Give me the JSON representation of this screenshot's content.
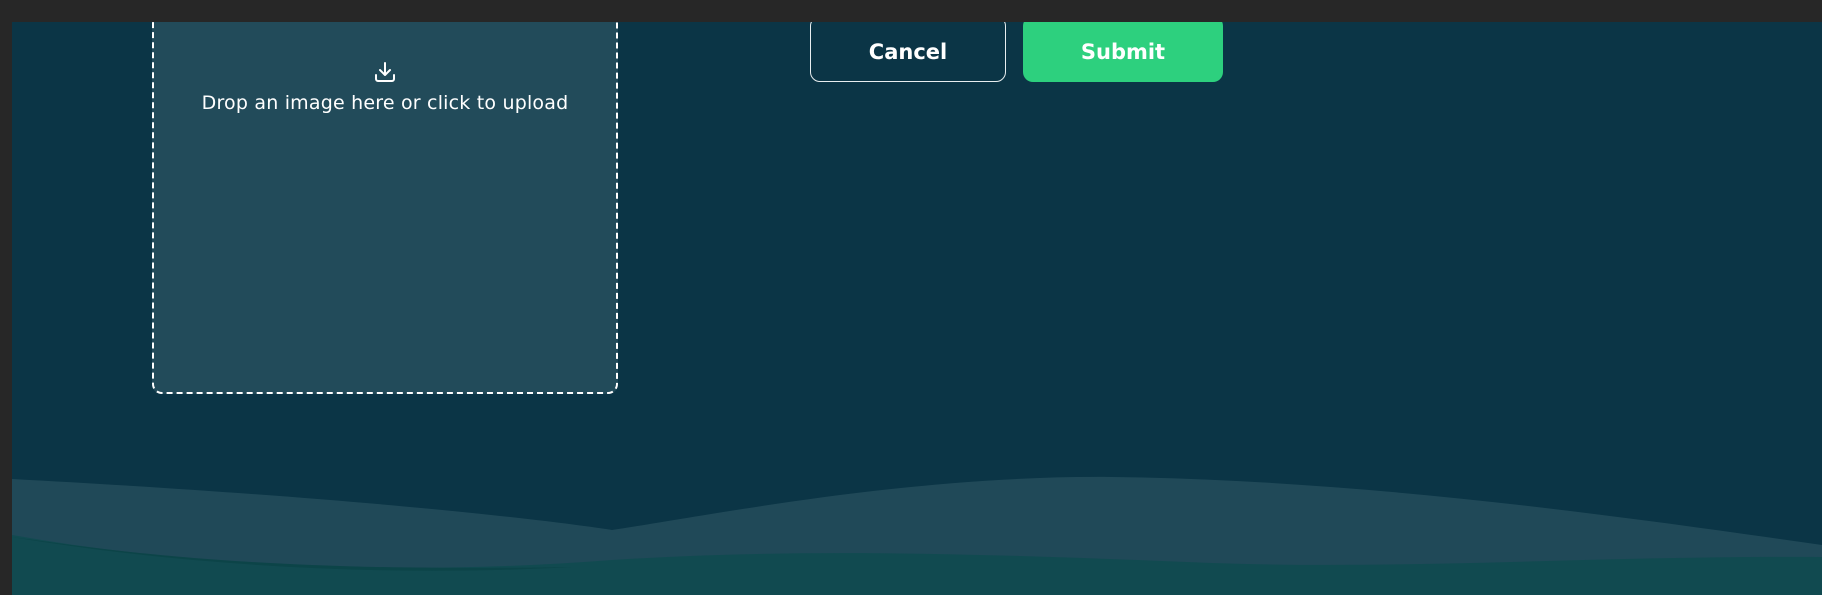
{
  "upload": {
    "text": "Drop an image here or click to upload",
    "icon": "download-icon"
  },
  "actions": {
    "cancel_label": "Cancel",
    "submit_label": "Submit"
  },
  "colors": {
    "background": "#0b3546",
    "dropzone": "#224b5a",
    "submit": "#2dd07e",
    "chrome": "#272727"
  }
}
